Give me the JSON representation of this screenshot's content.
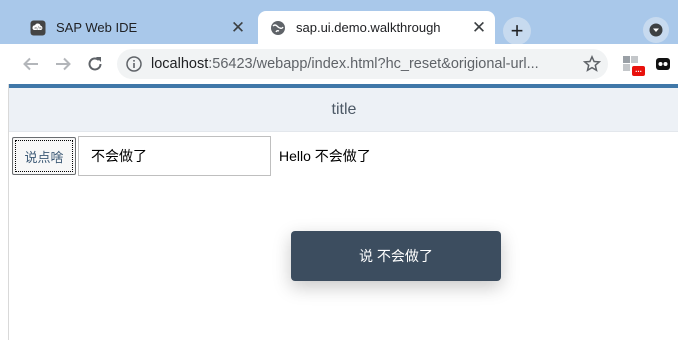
{
  "browser": {
    "tabs": [
      {
        "title": "SAP Web IDE",
        "icon": "sap-webide-icon",
        "active": false
      },
      {
        "title": "sap.ui.demo.walkthrough",
        "icon": "globe-icon",
        "active": true
      }
    ],
    "new_tab_label": "+",
    "address": {
      "host": "localhost",
      "rest": ":56423/webapp/index.html?hc_reset&origional-url..."
    },
    "extension_badge": "...",
    "colors": {
      "tabstrip": "#a9c8ea",
      "accent": "#3f77a8"
    }
  },
  "app": {
    "header": {
      "title": "title"
    },
    "say_button_label": "说点啥",
    "name_input_value": "不会做了",
    "hello_text": "Hello 不会做了",
    "toast_text": "说 不会做了",
    "colors": {
      "toast": "#3c4d5f",
      "header_bg": "#edf1f6"
    }
  }
}
